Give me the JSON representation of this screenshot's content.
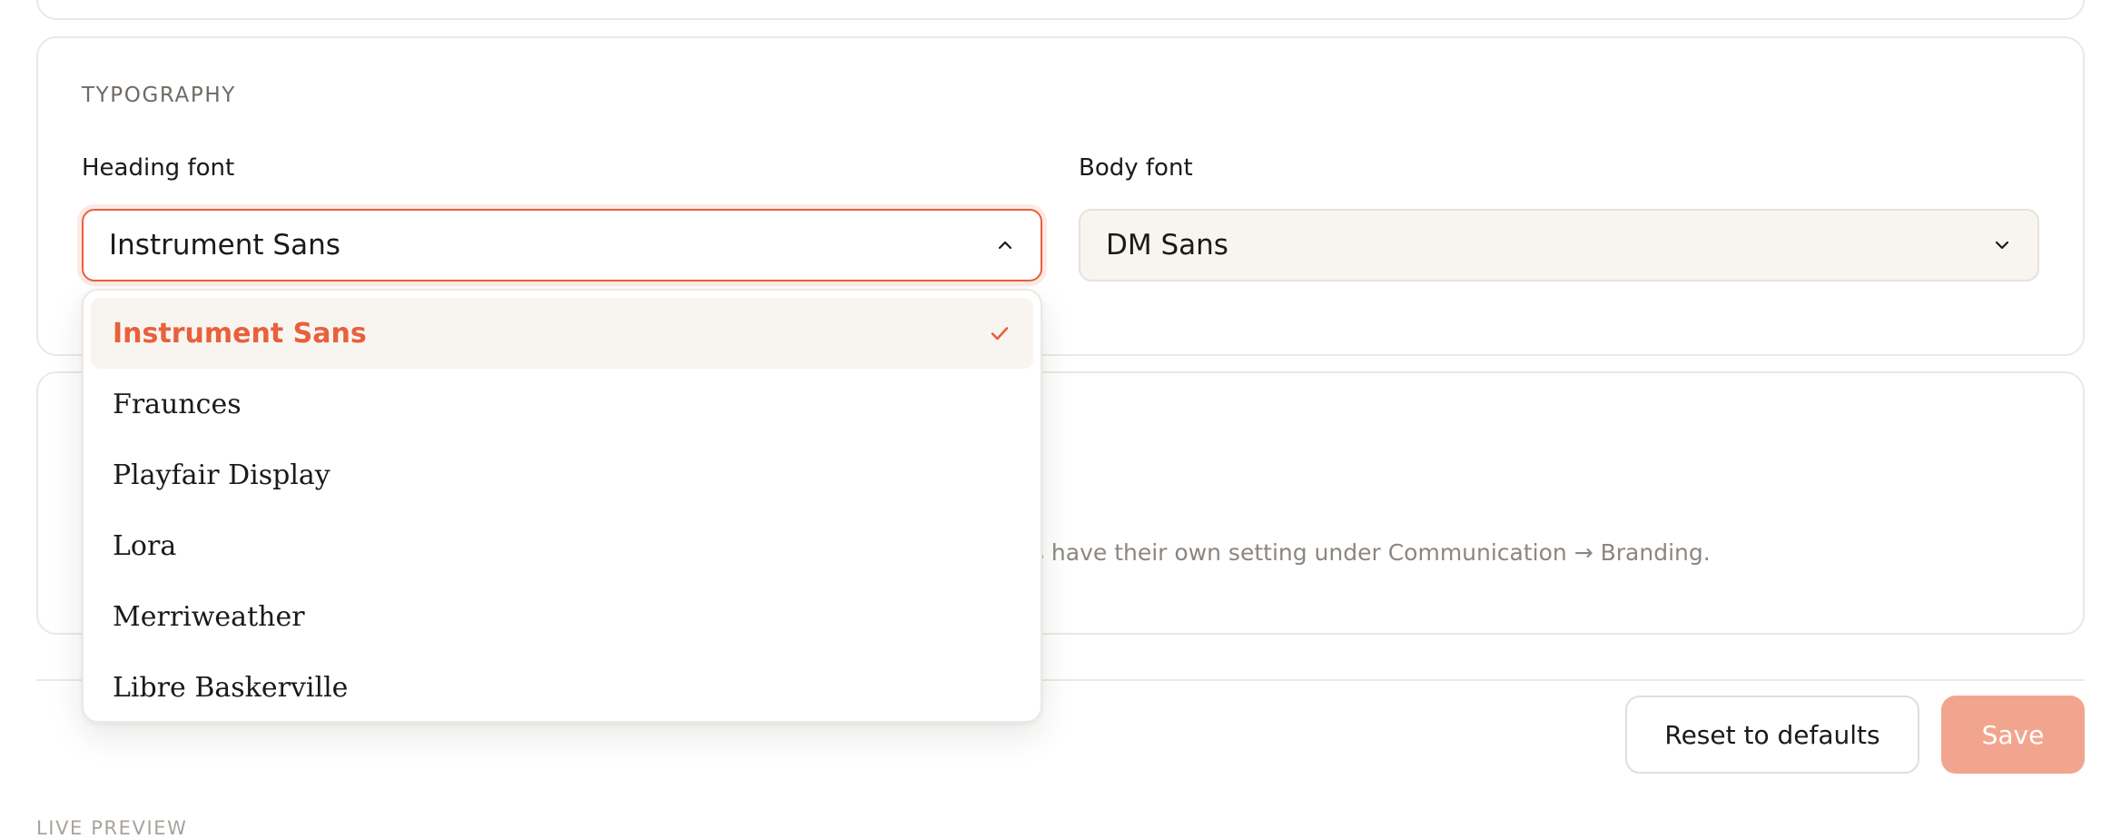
{
  "typography": {
    "section_label": "TYPOGRAPHY",
    "heading_font": {
      "label": "Heading font",
      "value": "Instrument Sans",
      "open": true,
      "options": [
        {
          "label": "Instrument Sans",
          "selected": true
        },
        {
          "label": "Fraunces",
          "selected": false
        },
        {
          "label": "Playfair Display",
          "selected": false
        },
        {
          "label": "Lora",
          "selected": false
        },
        {
          "label": "Merriweather",
          "selected": false
        },
        {
          "label": "Libre Baskerville",
          "selected": false
        }
      ]
    },
    "body_font": {
      "label": "Body font",
      "value": "DM Sans"
    }
  },
  "hint_text": "ls have their own setting under Communication → Branding.",
  "actions": {
    "reset_label": "Reset to defaults",
    "save_label": "Save"
  },
  "live_preview_label": "LIVE PREVIEW",
  "colors": {
    "accent": "#e8603c",
    "save_button": "#f2a58e",
    "select_bg": "#f8f5f0",
    "muted_text": "#8c8680"
  },
  "icons": {
    "heading_select": "chevron-up-icon",
    "body_select": "chevron-down-icon",
    "selected_option": "check-icon"
  }
}
